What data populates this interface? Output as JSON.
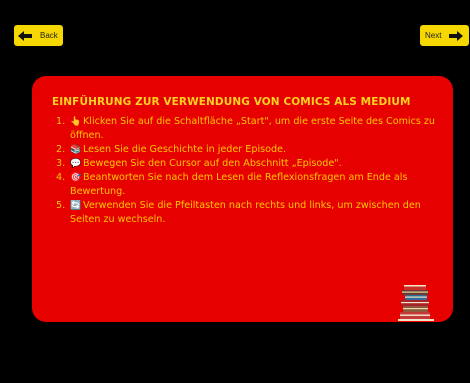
{
  "nav": {
    "back_label": "Back",
    "next_label": "Next"
  },
  "panel": {
    "title": "EINFÜHRUNG ZUR VERWENDUNG VON COMICS ALS MEDIUM",
    "steps": [
      {
        "number": "1.",
        "icon": "pointing-hand-icon",
        "icon_glyph": "👆",
        "text": "Klicken Sie auf die Schaltfläche „Start\", um die erste Seite des Comics zu öffnen."
      },
      {
        "number": "2.",
        "icon": "book-stack-icon",
        "icon_glyph": "📚",
        "text": "Lesen Sie die Geschichte in jeder Episode."
      },
      {
        "number": "3.",
        "icon": "speech-bubble-icon",
        "icon_glyph": "💬",
        "text": "Bewegen Sie den Cursor auf den Abschnitt „Episode\"."
      },
      {
        "number": "4.",
        "icon": "target-icon",
        "icon_glyph": "🎯",
        "text": "Beantworten Sie nach dem Lesen die Reflexionsfragen am Ende als Bewertung."
      },
      {
        "number": "5.",
        "icon": "refresh-icon",
        "icon_glyph": "🔄",
        "text": "Verwenden Sie die Pfeiltasten nach rechts und links, um zwischen den Seiten zu wechseln."
      }
    ],
    "illustration": "stack-of-books-icon"
  },
  "colors": {
    "background": "#000000",
    "button": "#f7d700",
    "panel": "#e60000",
    "title": "#ffd21f",
    "text": "#ffc800"
  }
}
